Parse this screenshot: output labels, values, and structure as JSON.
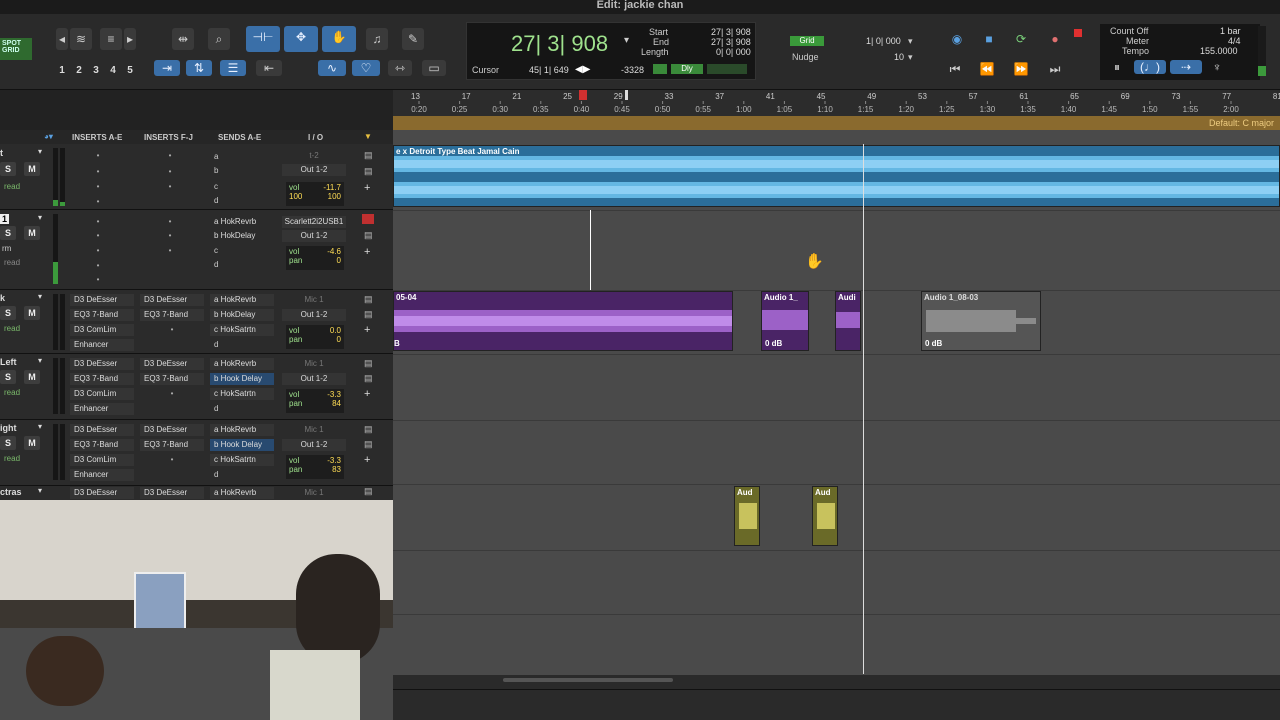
{
  "window": {
    "title": "Edit: jackie chan"
  },
  "toolbar": {
    "spot_label": "SPOT",
    "grid_label": "GRID",
    "zoom_presets": [
      "1",
      "2",
      "3",
      "4",
      "5"
    ]
  },
  "counter": {
    "main": "27| 3| 908",
    "start_label": "Start",
    "start_value": "27| 3| 908",
    "end_label": "End",
    "end_value": "27| 3| 908",
    "length_label": "Length",
    "length_value": "0| 0| 000",
    "cursor_label": "Cursor",
    "cursor_value": "45| 1| 649",
    "cursor_offset": "-3328",
    "dly_label": "Dly"
  },
  "grid": {
    "label": "Grid",
    "value": "1| 0| 000",
    "nudge_label": "Nudge",
    "nudge_value": "10"
  },
  "meter": {
    "count_off": "Count Off",
    "meter_label": "Meter",
    "tempo_label": "Tempo",
    "bar": "1 bar",
    "signature": "4/4",
    "tempo": "155.0000"
  },
  "ruler": {
    "bars": [
      "13",
      "17",
      "21",
      "25",
      "29",
      "33",
      "37",
      "41",
      "45",
      "49",
      "53",
      "57",
      "61",
      "65",
      "69",
      "73",
      "77",
      "81"
    ],
    "times": [
      "0:20",
      "0:25",
      "0:30",
      "0:35",
      "0:40",
      "0:45",
      "0:50",
      "0:55",
      "1:00",
      "1:05",
      "1:10",
      "1:15",
      "1:20",
      "1:25",
      "1:30",
      "1:35",
      "1:40",
      "1:45",
      "1:50",
      "1:55",
      "2:00"
    ],
    "key": "Default: C major"
  },
  "mix_header": {
    "inserts_ae": "INSERTS A-E",
    "inserts_fj": "INSERTS F-J",
    "sends_ae": "SENDS A-E",
    "io": "I / O"
  },
  "tracks": [
    {
      "name": "t",
      "s": "S",
      "m": "M",
      "mode": "read",
      "vol_label": "vol",
      "vol": "-11.7",
      "pan_l": "100",
      "pan_r": "100",
      "in": "t-2",
      "out": "Out 1-2",
      "sends": [
        "a",
        "b",
        "c",
        "d"
      ]
    },
    {
      "name": "1",
      "s": "S",
      "m": "M",
      "mode": "read",
      "vol_label": "vol",
      "vol": "-4.6",
      "pan_label": "pan",
      "pan": "0",
      "in": "Scarlett2i2USB1",
      "out": "Out 1-2",
      "sends": [
        "a HokRevrb",
        "b HokDelay",
        "c",
        "d"
      ],
      "side": "rm"
    },
    {
      "name": "k",
      "s": "S",
      "m": "M",
      "mode": "read",
      "vol_label": "vol",
      "vol": "0.0",
      "pan_label": "pan",
      "pan": "0",
      "in": "Mic 1",
      "out": "Out 1-2",
      "inserts": [
        "D3 DeEsser",
        "EQ3 7-Band",
        "D3 ComLim",
        "Enhancer"
      ],
      "inserts2": [
        "D3 DeEsser",
        "EQ3 7-Band"
      ],
      "sends": [
        "a HokRevrb",
        "b HokDelay",
        "c HokSatrtn",
        "d"
      ]
    },
    {
      "name": "Left",
      "s": "S",
      "m": "M",
      "mode": "read",
      "vol_label": "vol",
      "vol": "-3.3",
      "pan_label": "pan",
      "pan": "84",
      "in": "Mic 1",
      "out": "Out 1-2",
      "inserts": [
        "D3 DeEsser",
        "EQ3 7-Band",
        "D3 ComLim",
        "Enhancer"
      ],
      "inserts2": [
        "D3 DeEsser",
        "EQ3 7-Band"
      ],
      "sends": [
        "a HokRevrb",
        "b Hook Delay",
        "c HokSatrtn",
        "d"
      ]
    },
    {
      "name": "ight",
      "s": "S",
      "m": "M",
      "mode": "read",
      "vol_label": "vol",
      "vol": "-3.3",
      "pan_label": "pan",
      "pan": "83",
      "in": "Mic 1",
      "out": "Out 1-2",
      "inserts": [
        "D3 DeEsser",
        "EQ3 7-Band",
        "D3 ComLim",
        "Enhancer"
      ],
      "inserts2": [
        "D3 DeEsser",
        "EQ3 7-Band"
      ],
      "sends": [
        "a HokRevrb",
        "b Hook Delay",
        "c HokSatrtn",
        "d"
      ]
    },
    {
      "name": "ctras",
      "inserts": [
        "D3 DeEsser"
      ],
      "inserts2": [
        "D3 DeEsser"
      ],
      "sends": [
        "a HokRevrb"
      ],
      "in": "Mic 1"
    }
  ],
  "clips": {
    "beat": "e x Detroit Type Beat Jamal Cain",
    "vox_a": "05-04",
    "vox_a_suffix": "B",
    "vox_b": "Audio 1_",
    "vox_b_gain": "0 dB",
    "vox_c": "Audi",
    "vox_d": "Audio 1_08-03",
    "vox_d_gain": "0 dB",
    "adlib_1": "Aud",
    "adlib_2": "Aud"
  },
  "colors": {
    "beat": "#3d9ad4",
    "vocal": "#7a3ea8",
    "adlib": "#b0a63a",
    "counter": "#9fe28d",
    "record": "#e03030"
  }
}
